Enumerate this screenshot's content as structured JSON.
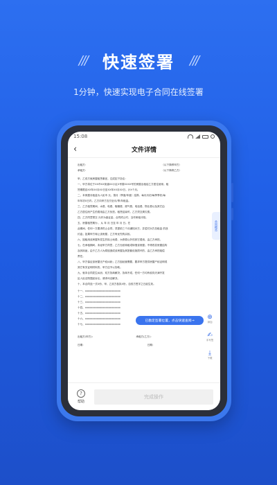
{
  "header": {
    "title": "快速签署",
    "decor_left": "///",
    "decor_right": "///",
    "subtitle": "1分钟，快速实现电子合同在线签署"
  },
  "phone": {
    "status_time": "15:08",
    "nav": {
      "back_icon": "chevron-left-icon",
      "title": "文件详情"
    },
    "document": {
      "party_a_label": "出租方：",
      "party_a_value": "（以下简称甲方）",
      "party_b_label": "承租方：",
      "party_b_value": "（以下简称乙方）",
      "lines": [
        "甲、乙双方就房屋租赁事宜，达成如下协议：",
        "一、甲方将位于XX市XX街道XX小区X号楼XXXX号的房屋出租给乙方居住使用，租",
        "赁期限自XX年XX月XX日至XX年XX月XX日，计X个月。",
        "二、本房屋月租金为人民币    元，按月（季度/年度）结算。每月月初/每季季初/每",
        "年年初X日内，乙方向甲方支付全月/季/年租金。",
        "三、乙方租赁期间，水费、电费、取暖费、燃气费、电话费、物业费以及其它由",
        "乙方居住而产生的费用由乙方负担。租赁结束时，乙方须交清欠费。",
        "四、乙方同意预交     元作为保证金，合同终止时，当作房租冲抵。",
        "五、房屋租赁期为     ，从    年    月    日至    年    月    日。在",
        "此期间，任何一方要求终止合同，须提前三个月通知对方，并偿付对方总租金    的违",
        "约金；如果甲方转让该房屋，乙方有优先购买权。",
        "六、因租用该房屋所发生的除土地费、大修费以外的其它费用，由乙方承担。",
        "七、在承租期间，未经甲方同意，乙方无权转租或转借该房屋；不得改变房屋结构",
        "及其用途，由于乙方人为原因造成该房屋及其配套设施损坏的，由乙方承担赔偿",
        "责任。",
        "八、甲方保证该房屋无产权纠纷；乙方因经营需要，要求甲方提供房屋产权证明或",
        "其它有关证明材料的，甲方应予以协助。",
        "九、就本合同发生纠纷，双方协商解决，协商不成，任何一方均有权向天津开发",
        "区人民法院提起诉讼，请求司法解决。",
        "十、本合同连一式X份，甲、乙双方各执X份，自双方签字之日起生效。"
      ],
      "numbered": [
        "十一、xxxxxxxxxxxxxxxxxxxxxxxx",
        "十二、xxxxxxxxxxxxxxxxxxxxxxxx",
        "十三、xxxxxxxxxxxxxxxxxxxxxxxx",
        "十四、xxxxxxxxxxxxxxxxxxxxxxxx",
        "十五、xxxxxxxxxxxxxxxxxxxxxxxx",
        "十六、xxxxxxxxxxxxxxxxxxxxxxxx",
        "十七、xxxxxxxxxxxxxxxxxxxxxxxx"
      ],
      "sign_a": "出租方(甲方)：",
      "sign_b": "承租方(乙方)：",
      "date_a": "日期：",
      "date_b": "日期："
    },
    "side_tab": "合同概览",
    "toast": "已勘定签署位置，点击快速查阅→",
    "tools": [
      {
        "icon": "plus-circle-icon",
        "label": "添加"
      },
      {
        "icon": "hand-sign-icon",
        "label": "手写签"
      },
      {
        "icon": "download-icon",
        "label": "下载"
      }
    ],
    "bottom": {
      "help_icon": "question-icon",
      "help_label": "帮助",
      "finish_label": "完成操作"
    }
  }
}
